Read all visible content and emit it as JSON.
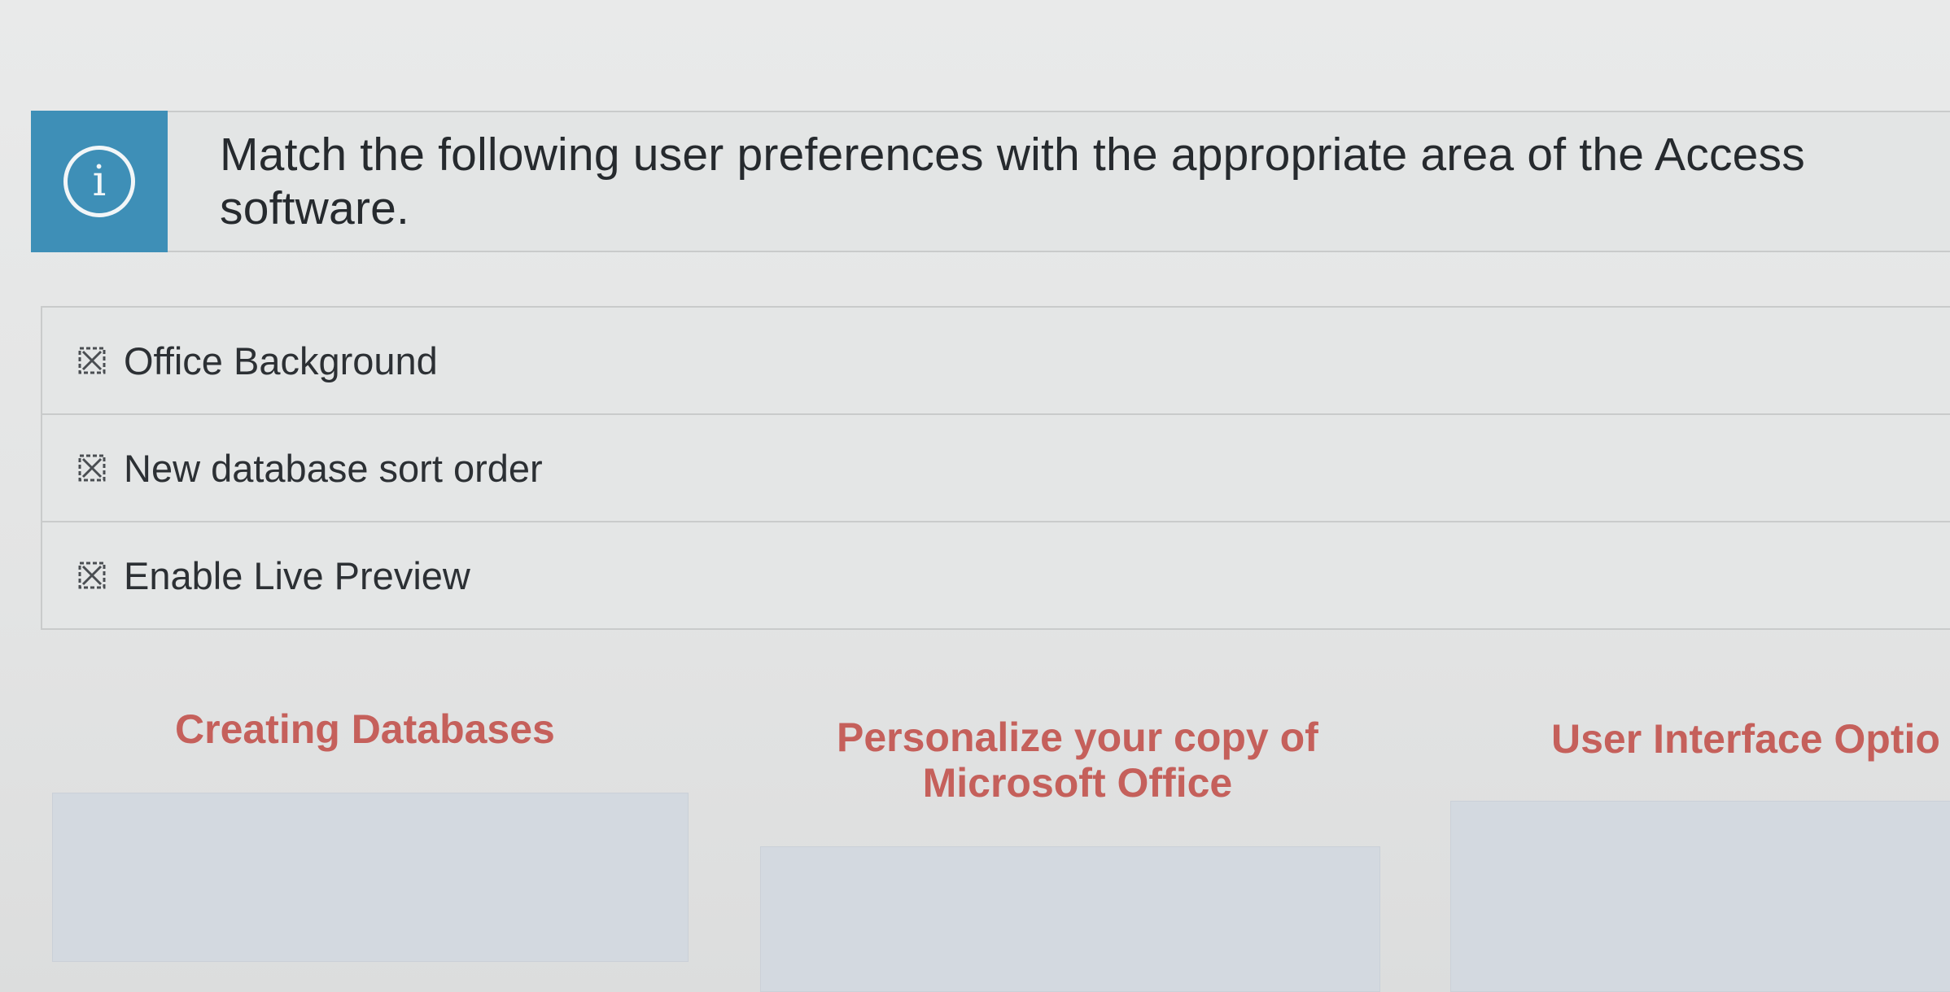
{
  "instruction": {
    "icon": "info-icon",
    "icon_glyph": "i",
    "text": "Match the following user preferences with the appropriate area of the Access software."
  },
  "items": [
    {
      "icon": "drag-handle-icon",
      "label": "Office Background"
    },
    {
      "icon": "drag-handle-icon",
      "label": "New database sort order"
    },
    {
      "icon": "drag-handle-icon",
      "label": "Enable Live Preview"
    }
  ],
  "targets": [
    {
      "title": "Creating Databases"
    },
    {
      "title_line1": "Personalize your copy of",
      "title_line2": "Microsoft Office"
    },
    {
      "title": "User Interface Optio"
    }
  ],
  "colors": {
    "info_accent": "#3e8fb7",
    "target_title": "#c5605b",
    "drop_zone": "#d3d9e0"
  }
}
